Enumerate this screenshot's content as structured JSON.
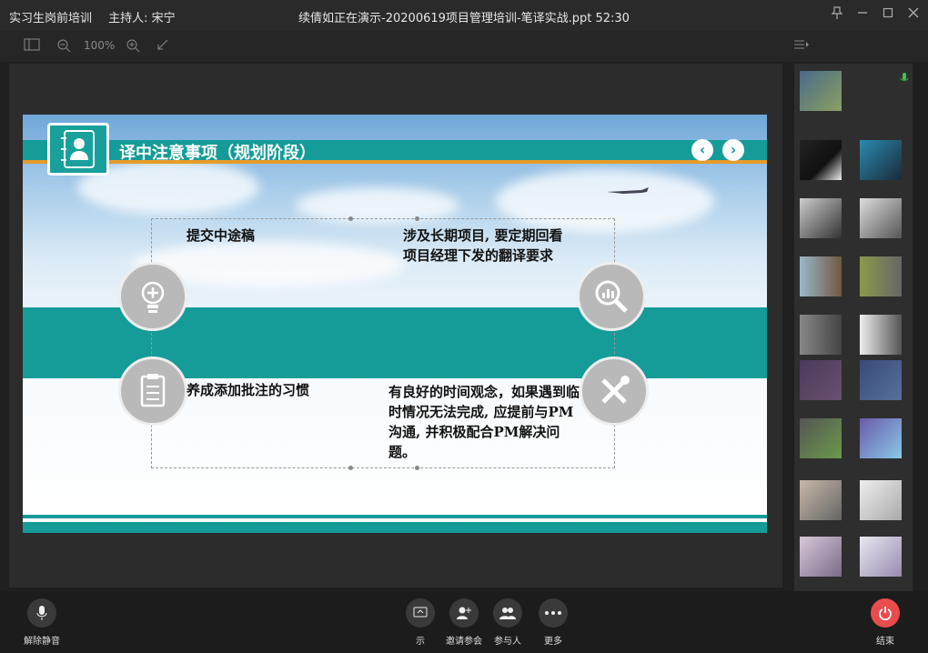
{
  "titlebar": {
    "app_name": "实习生岗前培训",
    "host": "主持人: 宋宁",
    "window_title": "续倩如正在演示-20200619项目管理培训-笔译实战.ppt 52:30"
  },
  "toolbar": {
    "zoom": "100%"
  },
  "slide": {
    "title": "译中注意事项（规划阶段）",
    "prev_glyph": "‹",
    "next_glyph": "›",
    "tl_text": "提交中途稿",
    "tr_text": "涉及长期项目, 要定期回看项目经理下发的翻译要求",
    "bl_text": "养成添加批注的习惯",
    "br_text": "有良好的时间观念，如果遇到临时情况无法完成, 应提前与PM沟通, 并积极配合PM解决问题。"
  },
  "bottom": {
    "mute_label": "解除静音",
    "share_label": "示",
    "invite_label": "邀请参会",
    "participants_label": "参与人",
    "more_label": "更多",
    "end_label": "结束"
  }
}
